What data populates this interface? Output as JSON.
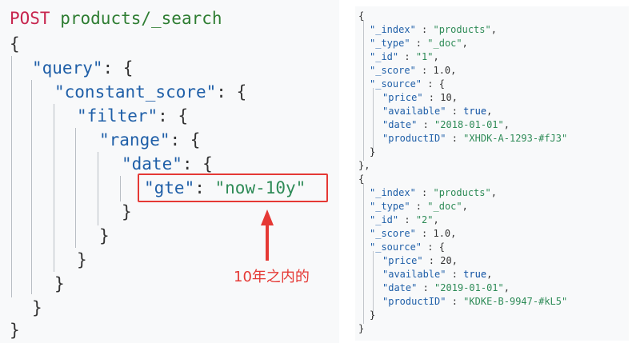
{
  "request": {
    "method": "POST",
    "path": "products/_search",
    "keys": {
      "query": "\"query\"",
      "constant_score": "\"constant_score\"",
      "filter": "\"filter\"",
      "range": "\"range\"",
      "date": "\"date\"",
      "gte": "\"gte\""
    },
    "gte_value": "\"now-10y\""
  },
  "annotation": {
    "text": "10年之内的",
    "color": "#e53935"
  },
  "response": {
    "hits": [
      {
        "_index": "\"products\"",
        "_type": "\"_doc\"",
        "_id": "\"1\"",
        "_score": "1.0",
        "price": "10",
        "available": "true",
        "date": "\"2018-01-01\"",
        "productID": "\"XHDK-A-1293-#fJ3\""
      },
      {
        "_index": "\"products\"",
        "_type": "\"_doc\"",
        "_id": "\"2\"",
        "_score": "1.0",
        "price": "20",
        "available": "true",
        "date": "\"2019-01-01\"",
        "productID": "\"KDKE-B-9947-#kL5\""
      }
    ]
  }
}
